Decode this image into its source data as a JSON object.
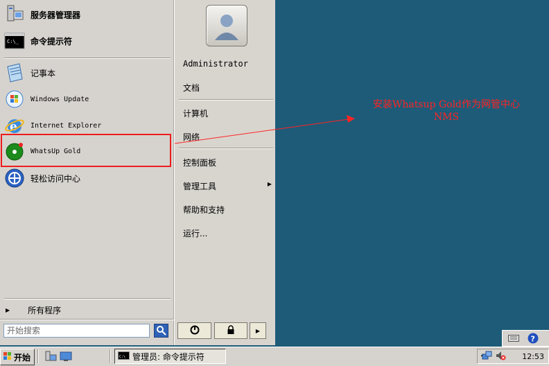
{
  "start_menu": {
    "pinned": [
      {
        "label": "服务器管理器",
        "icon": "server-manager-icon"
      },
      {
        "label": "命令提示符",
        "icon": "cmd-icon"
      }
    ],
    "recent": [
      {
        "label": "记事本",
        "icon": "notepad-icon"
      },
      {
        "label": "Windows Update",
        "icon": "windows-update-icon"
      },
      {
        "label": "Internet Explorer",
        "icon": "ie-icon"
      },
      {
        "label": "WhatsUp Gold",
        "icon": "whatsup-gold-icon"
      },
      {
        "label": "轻松访问中心",
        "icon": "ease-of-access-icon"
      }
    ],
    "all_programs": "所有程序",
    "search_placeholder": "开始搜索",
    "right": {
      "user": "Administrator",
      "documents": "文档",
      "computer": "计算机",
      "network": "网络",
      "control_panel": "控制面板",
      "admin_tools": "管理工具",
      "help": "帮助和支持",
      "run": "运行..."
    }
  },
  "annotation": {
    "line1": "安装Whatsup Gold作为网管中心",
    "line2": "NMS",
    "color": "#ff2424"
  },
  "taskbar": {
    "start_label": "开始",
    "task_label": "管理员: 命令提示符",
    "clock": "12:53",
    "overflow": "«"
  },
  "colors": {
    "desktop": "#1e5b78",
    "menu": "#d6d3ce",
    "highlight": "#ee1c1c"
  }
}
